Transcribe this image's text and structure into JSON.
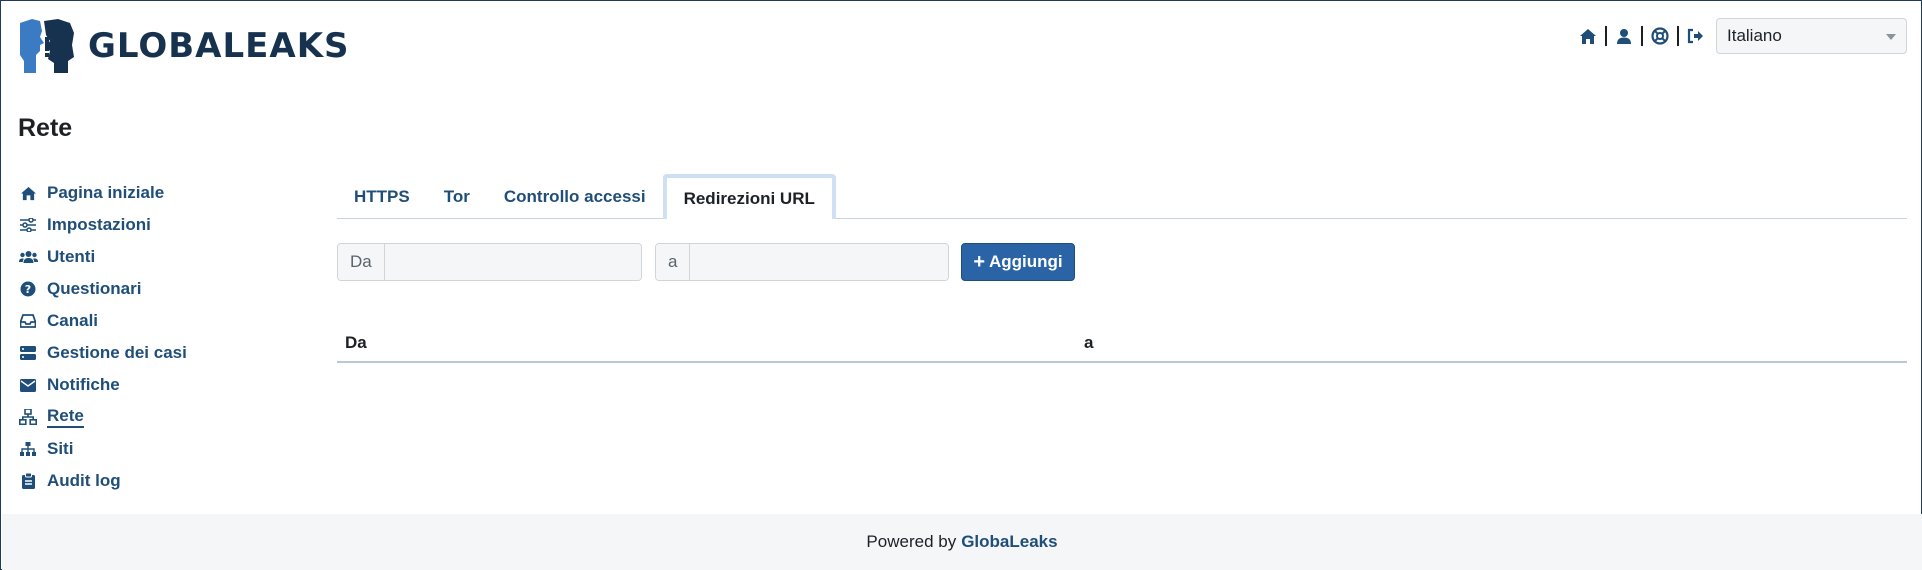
{
  "brand": {
    "logo_text": "GLOBALEAKS",
    "color": "#16324f",
    "accent": "#3b7bc4"
  },
  "header": {
    "icons": [
      {
        "name": "home-icon"
      },
      {
        "name": "user-icon"
      },
      {
        "name": "help-icon"
      },
      {
        "name": "logout-icon"
      }
    ],
    "language": {
      "selected": "Italiano"
    }
  },
  "page": {
    "title": "Rete"
  },
  "sidebar": {
    "items": [
      {
        "label": "Pagina iniziale",
        "icon": "home-icon"
      },
      {
        "label": "Impostazioni",
        "icon": "sliders-icon"
      },
      {
        "label": "Utenti",
        "icon": "users-icon"
      },
      {
        "label": "Questionari",
        "icon": "question-circle-icon"
      },
      {
        "label": "Canali",
        "icon": "inbox-icon"
      },
      {
        "label": "Gestione dei casi",
        "icon": "server-icon"
      },
      {
        "label": "Notifiche",
        "icon": "envelope-icon"
      },
      {
        "label": "Rete",
        "icon": "network-icon",
        "active": true
      },
      {
        "label": "Siti",
        "icon": "sitemap-icon"
      },
      {
        "label": "Audit log",
        "icon": "clipboard-icon"
      }
    ]
  },
  "tabs": [
    {
      "label": "HTTPS"
    },
    {
      "label": "Tor"
    },
    {
      "label": "Controllo accessi"
    },
    {
      "label": "Redirezioni URL",
      "active": true
    }
  ],
  "form": {
    "from_label": "Da",
    "from_value": "",
    "to_label": "a",
    "to_value": "",
    "add_label": "Aggiungi"
  },
  "table": {
    "columns": [
      "Da",
      "a"
    ]
  },
  "footer": {
    "text": "Powered by",
    "brand": "GlobaLeaks"
  },
  "colors": {
    "link": "#1f4e79",
    "primary_button": "#2a64a6",
    "active_tab_border": "#cfe0f5"
  }
}
